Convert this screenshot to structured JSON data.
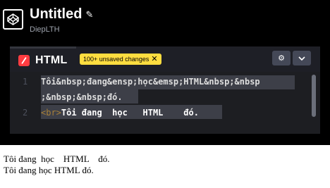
{
  "header": {
    "title": "Untitled",
    "edit_icon": "pencil-icon",
    "author": "DiepLTH",
    "logo_icon": "codepen-logo-icon"
  },
  "editor": {
    "tab_label": "HTML",
    "tab_icon": "html-slash-icon",
    "unsaved_badge": "100+ unsaved changes",
    "unsaved_close_icon": "close-icon",
    "settings_icon": "gear-icon",
    "collapse_icon": "chevron-down-icon",
    "line_numbers": [
      "1",
      "2"
    ],
    "code_line1a": "Tôi&nbsp;đang&ensp;học&emsp;HTML&nbsp;&nbsp",
    "code_line1b": ";&nbsp;&nbsp;đó.",
    "code_line2_tag": "<br>",
    "code_line2_text": "Tôi đang  học   HTML    đó."
  },
  "output": {
    "line1": "Tôi đang  học    HTML    đó.",
    "line2": "Tôi đang học HTML đó."
  },
  "colors": {
    "background": "#000000",
    "editor_bg": "#1d1e22",
    "selection": "#3d3f48",
    "html_badge": "#ff3c41",
    "unsaved_badge": "#ffdd40",
    "tag": "#a88038",
    "button": "#444857"
  }
}
